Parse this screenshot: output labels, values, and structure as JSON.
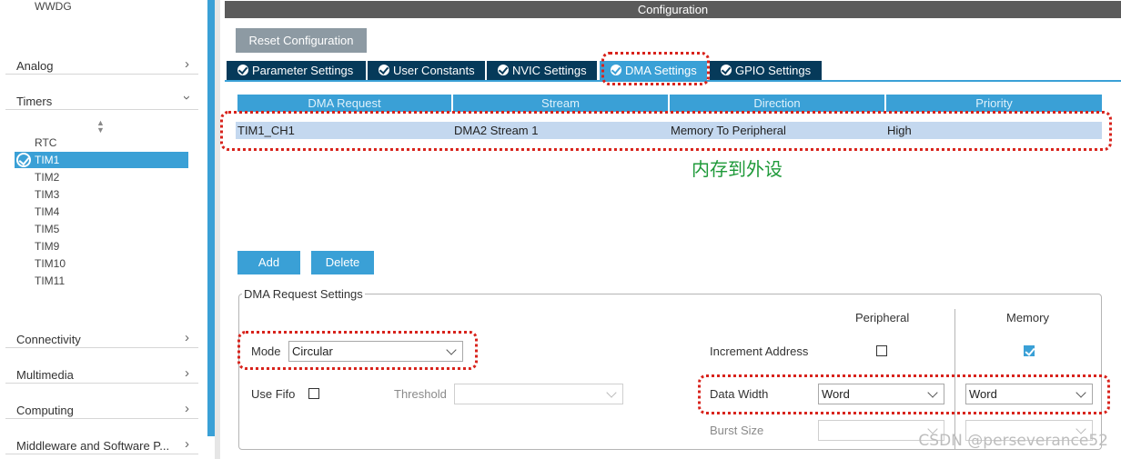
{
  "sidebar": {
    "top_item": "WWDG",
    "categories": {
      "analog": "Analog",
      "timers": "Timers",
      "connectivity": "Connectivity",
      "multimedia": "Multimedia",
      "computing": "Computing",
      "middleware": "Middleware and Software P..."
    },
    "timers": [
      "RTC",
      "TIM1",
      "TIM2",
      "TIM3",
      "TIM4",
      "TIM5",
      "TIM9",
      "TIM10",
      "TIM11"
    ],
    "selected_timer": "TIM1"
  },
  "config": {
    "title": "Configuration",
    "reset_label": "Reset Configuration",
    "tabs": [
      "Parameter Settings",
      "User Constants",
      "NVIC Settings",
      "DMA Settings",
      "GPIO Settings"
    ],
    "active_tab": "DMA Settings"
  },
  "table": {
    "headers": [
      "DMA Request",
      "Stream",
      "Direction",
      "Priority"
    ],
    "rows": [
      [
        "TIM1_CH1",
        "DMA2 Stream 1",
        "Memory To Peripheral",
        "High"
      ]
    ]
  },
  "annotation": "内存到外设",
  "buttons": {
    "add": "Add",
    "delete": "Delete"
  },
  "settings": {
    "legend": "DMA Request Settings",
    "peripheral_header": "Peripheral",
    "memory_header": "Memory",
    "mode_label": "Mode",
    "mode_value": "Circular",
    "increment_label": "Increment Address",
    "peripheral_increment": false,
    "memory_increment": true,
    "use_fifo_label": "Use Fifo",
    "use_fifo": false,
    "threshold_label": "Threshold",
    "threshold_value": "",
    "data_width_label": "Data Width",
    "peripheral_data_width": "Word",
    "memory_data_width": "Word",
    "burst_size_label": "Burst Size"
  },
  "watermark": "CSDN @perseverance52",
  "colors": {
    "accent": "#3aa0d6",
    "tab_dark": "#063a5a",
    "annotation_red": "#d8231c",
    "annotation_green": "#1f9a3a"
  }
}
